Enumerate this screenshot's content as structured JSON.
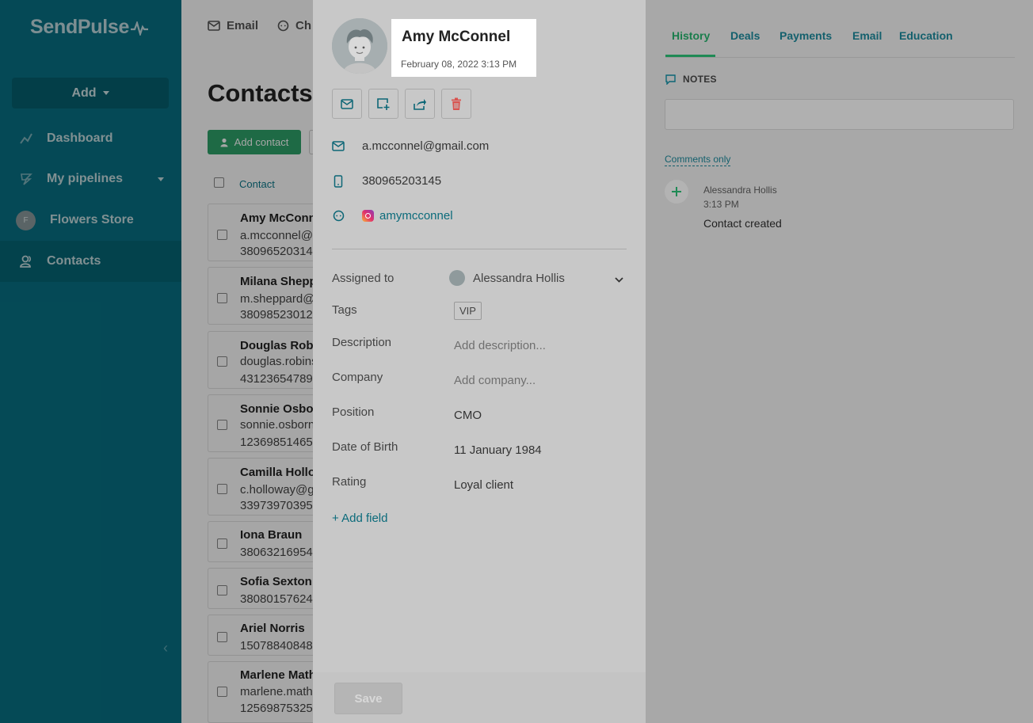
{
  "sidebar": {
    "logo": "SendPulse",
    "add_label": "Add",
    "items": [
      {
        "label": "Dashboard",
        "icon": "dashboard-icon"
      },
      {
        "label": "My pipelines",
        "icon": "pipelines-icon"
      },
      {
        "label": "Flowers Store",
        "icon": "avatar",
        "avatar_letter": "F"
      },
      {
        "label": "Contacts",
        "icon": "contacts-icon"
      }
    ],
    "collapse_icon": "chevron-left-icon"
  },
  "topnav": {
    "email": "Email",
    "chat": "Ch"
  },
  "page": {
    "title": "Contacts",
    "add_contact": "Add contact",
    "column_contact": "Contact"
  },
  "contacts_rows": [
    {
      "name": "Amy McConn",
      "line2": "a.mcconnel@g",
      "line3": "38096520314"
    },
    {
      "name": "Milana Shepp",
      "line2": "m.sheppard@",
      "line3": "38098523012"
    },
    {
      "name": "Douglas Robi",
      "line2": "douglas.robins",
      "line3": "43123654789"
    },
    {
      "name": "Sonnie Osbor",
      "line2": "sonnie.osborn",
      "line3": "12369851465"
    },
    {
      "name": "Camilla Hollo",
      "line2": "c.holloway@g",
      "line3": "33973970395"
    },
    {
      "name": "Iona Braun",
      "line2": "38063216954",
      "line3": ""
    },
    {
      "name": "Sofia Sexton",
      "line2": "38080157624",
      "line3": ""
    },
    {
      "name": "Ariel Norris",
      "line2": "15078840848",
      "line3": ""
    },
    {
      "name": "Marlene Math",
      "line2": "marlene.math",
      "line3": "12569875325"
    }
  ],
  "contact": {
    "name": "Amy McConnel",
    "created": "February 08, 2022 3:13 PM",
    "email": "a.mcconnel@gmail.com",
    "phone": "380965203145",
    "instagram": "amymcconnel",
    "fields": {
      "assigned_label": "Assigned to",
      "assigned_value": "Alessandra Hollis",
      "tags_label": "Tags",
      "tag": "VIP",
      "description_label": "Description",
      "description_placeholder": "Add description...",
      "company_label": "Company",
      "company_placeholder": "Add company...",
      "position_label": "Position",
      "position_value": "CMO",
      "dob_label": "Date of Birth",
      "dob_value": "11 January 1984",
      "rating_label": "Rating",
      "rating_value": "Loyal client"
    },
    "add_field": "+ Add field",
    "save": "Save"
  },
  "history": {
    "tabs": [
      "History",
      "Deals",
      "Payments",
      "Email",
      "Education"
    ],
    "notes_title": "NOTES",
    "comments_only": "Comments only",
    "entry_author": "Alessandra Hollis",
    "entry_time": "3:13 PM",
    "entry_text": "Contact created"
  },
  "colors": {
    "sidebar": "#087184",
    "accent_green": "#2fa36a",
    "link": "#0b6b7b",
    "delete": "#d9534f"
  }
}
